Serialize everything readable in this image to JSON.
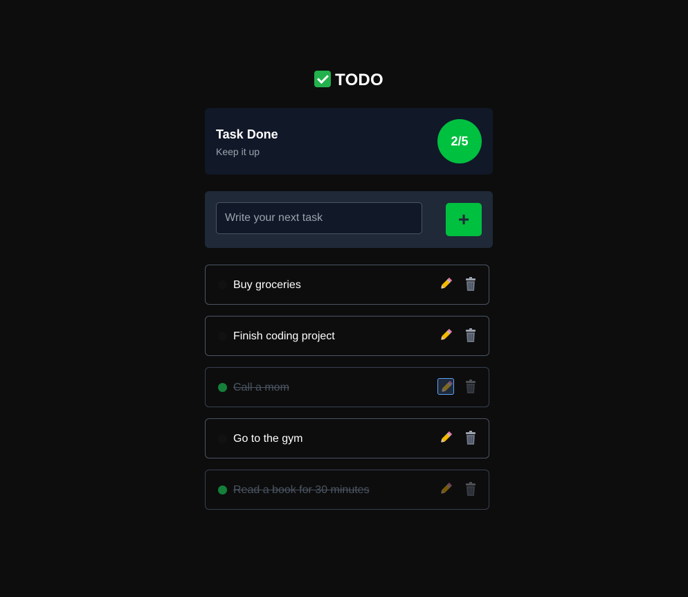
{
  "header": {
    "icon": "check-box-icon",
    "title": "TODO"
  },
  "stats": {
    "title": "Task Done",
    "subtitle": "Keep it up",
    "progress": "2/5",
    "accent_color": "#00c040"
  },
  "new_task": {
    "placeholder": "Write your next task",
    "value": "",
    "add_label": "+"
  },
  "tasks": [
    {
      "text": "Buy groceries",
      "done": false,
      "edit_icon": "pencil-icon",
      "delete_icon": "trash-icon"
    },
    {
      "text": "Finish coding project",
      "done": false,
      "edit_icon": "pencil-icon",
      "delete_icon": "trash-icon"
    },
    {
      "text": "Call a mom",
      "done": true,
      "edit_icon": "pencil-icon",
      "delete_icon": "trash-icon"
    },
    {
      "text": "Go to the gym",
      "done": false,
      "edit_icon": "pencil-icon",
      "delete_icon": "trash-icon"
    },
    {
      "text": "Read a book for 30 minutes",
      "done": true,
      "edit_icon": "pencil-icon",
      "delete_icon": "trash-icon"
    }
  ]
}
